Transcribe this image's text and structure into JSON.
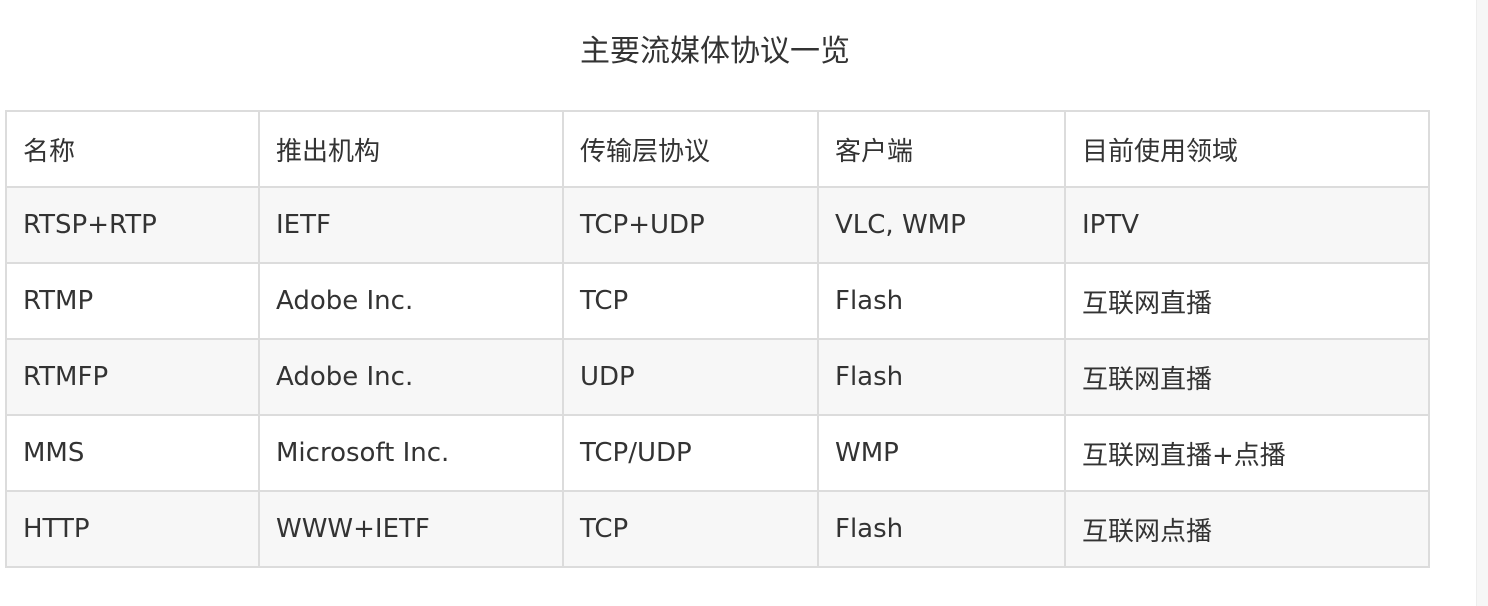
{
  "title": "主要流媒体协议一览",
  "table": {
    "headers": [
      "名称",
      "推出机构",
      "传输层协议",
      "客户端",
      "目前使用领域"
    ],
    "rows": [
      [
        "RTSP+RTP",
        "IETF",
        "TCP+UDP",
        "VLC, WMP",
        "IPTV"
      ],
      [
        "RTMP",
        "Adobe Inc.",
        "TCP",
        "Flash",
        "互联网直播"
      ],
      [
        "RTMFP",
        "Adobe Inc.",
        "UDP",
        "Flash",
        "互联网直播"
      ],
      [
        "MMS",
        "Microsoft Inc.",
        "TCP/UDP",
        "WMP",
        "互联网直播+点播"
      ],
      [
        "HTTP",
        "WWW+IETF",
        "TCP",
        "Flash",
        "互联网点播"
      ]
    ]
  }
}
